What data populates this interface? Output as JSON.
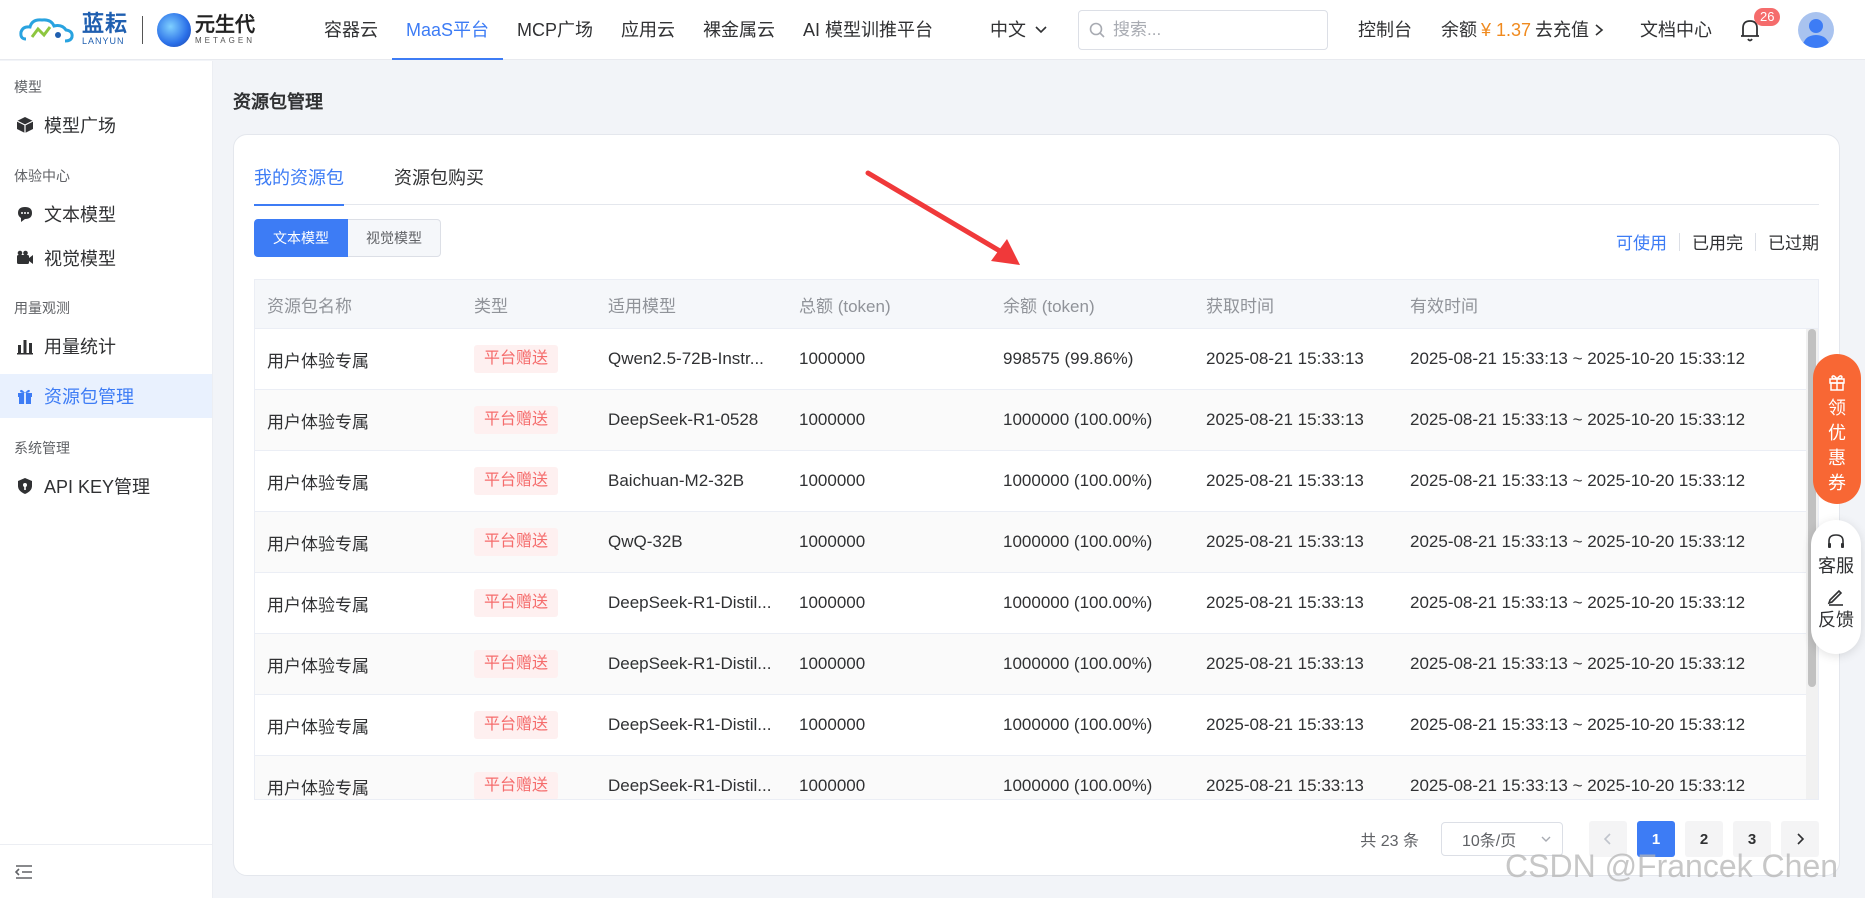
{
  "brand": {
    "lanyun_cn": "蓝耘",
    "lanyun_en": "LANYUN",
    "meta_cn": "元生代",
    "meta_en": "METAGEN"
  },
  "nav": {
    "items": [
      {
        "label": "容器云"
      },
      {
        "label": "MaaS平台",
        "active": true
      },
      {
        "label": "MCP广场"
      },
      {
        "label": "应用云"
      },
      {
        "label": "裸金属云"
      },
      {
        "label": "AI 模型训推平台"
      }
    ]
  },
  "header": {
    "language": "中文",
    "search_placeholder": "搜索...",
    "console": "控制台",
    "balance_label": "余额",
    "balance_amount": "¥ 1.37",
    "recharge": "去充值",
    "docs": "文档中心",
    "notification_count": "26"
  },
  "sidebar": {
    "groups": [
      {
        "title": "模型",
        "items": [
          {
            "label": "模型广场",
            "icon": "cube-icon"
          }
        ]
      },
      {
        "title": "体验中心",
        "items": [
          {
            "label": "文本模型",
            "icon": "chat-icon"
          },
          {
            "label": "视觉模型",
            "icon": "camera-icon"
          }
        ]
      },
      {
        "title": "用量观测",
        "items": [
          {
            "label": "用量统计",
            "icon": "bar-chart-icon"
          },
          {
            "label": "资源包管理",
            "icon": "gift-icon",
            "active": true
          }
        ]
      },
      {
        "title": "系统管理",
        "items": [
          {
            "label": "API KEY管理",
            "icon": "shield-icon"
          }
        ]
      }
    ]
  },
  "page": {
    "title": "资源包管理"
  },
  "tabs": [
    {
      "label": "我的资源包",
      "active": true
    },
    {
      "label": "资源包购买"
    }
  ],
  "model_types": [
    {
      "label": "文本模型",
      "active": true
    },
    {
      "label": "视觉模型"
    }
  ],
  "status_filters": [
    {
      "label": "可使用",
      "active": true
    },
    {
      "label": "已用完"
    },
    {
      "label": "已过期"
    }
  ],
  "table": {
    "columns": [
      "资源包名称",
      "类型",
      "适用模型",
      "总额 (token)",
      "余额 (token)",
      "获取时间",
      "有效时间"
    ],
    "rows": [
      [
        "用户体验专属",
        "平台赠送",
        "Qwen2.5-72B-Instr...",
        "1000000",
        "998575 (99.86%)",
        "2025-08-21 15:33:13",
        "2025-08-21 15:33:13 ~ 2025-10-20 15:33:12"
      ],
      [
        "用户体验专属",
        "平台赠送",
        "DeepSeek-R1-0528",
        "1000000",
        "1000000 (100.00%)",
        "2025-08-21 15:33:13",
        "2025-08-21 15:33:13 ~ 2025-10-20 15:33:12"
      ],
      [
        "用户体验专属",
        "平台赠送",
        "Baichuan-M2-32B",
        "1000000",
        "1000000 (100.00%)",
        "2025-08-21 15:33:13",
        "2025-08-21 15:33:13 ~ 2025-10-20 15:33:12"
      ],
      [
        "用户体验专属",
        "平台赠送",
        "QwQ-32B",
        "1000000",
        "1000000 (100.00%)",
        "2025-08-21 15:33:13",
        "2025-08-21 15:33:13 ~ 2025-10-20 15:33:12"
      ],
      [
        "用户体验专属",
        "平台赠送",
        "DeepSeek-R1-Distil...",
        "1000000",
        "1000000 (100.00%)",
        "2025-08-21 15:33:13",
        "2025-08-21 15:33:13 ~ 2025-10-20 15:33:12"
      ],
      [
        "用户体验专属",
        "平台赠送",
        "DeepSeek-R1-Distil...",
        "1000000",
        "1000000 (100.00%)",
        "2025-08-21 15:33:13",
        "2025-08-21 15:33:13 ~ 2025-10-20 15:33:12"
      ],
      [
        "用户体验专属",
        "平台赠送",
        "DeepSeek-R1-Distil...",
        "1000000",
        "1000000 (100.00%)",
        "2025-08-21 15:33:13",
        "2025-08-21 15:33:13 ~ 2025-10-20 15:33:12"
      ],
      [
        "用户体验专属",
        "平台赠送",
        "DeepSeek-R1-Distil...",
        "1000000",
        "1000000 (100.00%)",
        "2025-08-21 15:33:13",
        "2025-08-21 15:33:13 ~ 2025-10-20 15:33:12"
      ]
    ]
  },
  "pagination": {
    "total": "共 23 条",
    "page_size": "10条/页",
    "pages": [
      "1",
      "2",
      "3"
    ],
    "current": "1"
  },
  "float": {
    "promo": [
      "领",
      "优",
      "惠",
      "券"
    ],
    "support": "客服",
    "feedback": "反馈"
  },
  "watermark": "CSDN @Francek Chen",
  "colors": {
    "accent": "#3d7cf5",
    "tag_red": "#f56c6c",
    "promo": "#f86734",
    "balance": "#f08a1e"
  }
}
